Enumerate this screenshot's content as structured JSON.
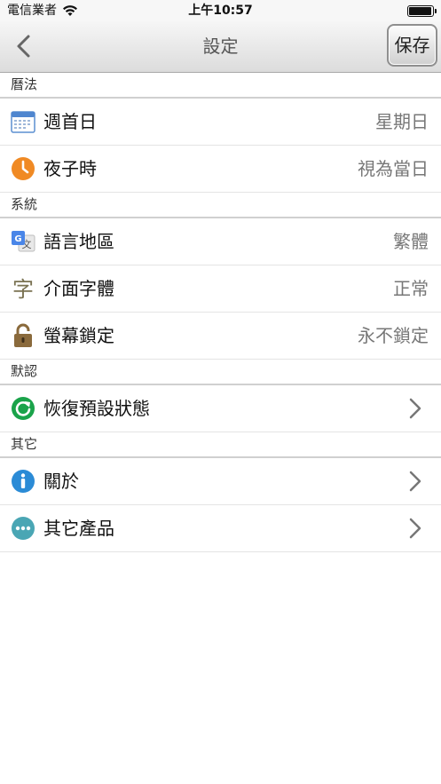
{
  "status_bar": {
    "carrier": "電信業者",
    "time": "上午10:57",
    "battery_level": 0.95
  },
  "nav": {
    "title": "設定",
    "save_label": "保存"
  },
  "sections": [
    {
      "header": "曆法",
      "rows": [
        {
          "label": "週首日",
          "value": "星期日",
          "icon": "calendar-icon"
        },
        {
          "label": "夜子時",
          "value": "視為當日",
          "icon": "clock-icon"
        }
      ]
    },
    {
      "header": "系統",
      "rows": [
        {
          "label": "語言地區",
          "value": "繁體",
          "icon": "translate-icon"
        },
        {
          "label": "介面字體",
          "value": "正常",
          "icon": "font-icon",
          "icon_glyph": "字"
        },
        {
          "label": "螢幕鎖定",
          "value": "永不鎖定",
          "icon": "lock-icon"
        }
      ]
    },
    {
      "header": "默認",
      "rows": [
        {
          "label": "恢復預設狀態",
          "icon": "reset-icon"
        }
      ]
    },
    {
      "header": "其它",
      "rows": [
        {
          "label": "關於",
          "icon": "info-icon"
        },
        {
          "label": "其它產品",
          "icon": "more-icon"
        }
      ]
    }
  ],
  "colors": {
    "clock_orange": "#f08a24",
    "reset_green": "#1aa34a",
    "info_blue": "#2b8bd6",
    "more_teal": "#4aa6b4",
    "lock_brown": "#8a6a3c"
  }
}
